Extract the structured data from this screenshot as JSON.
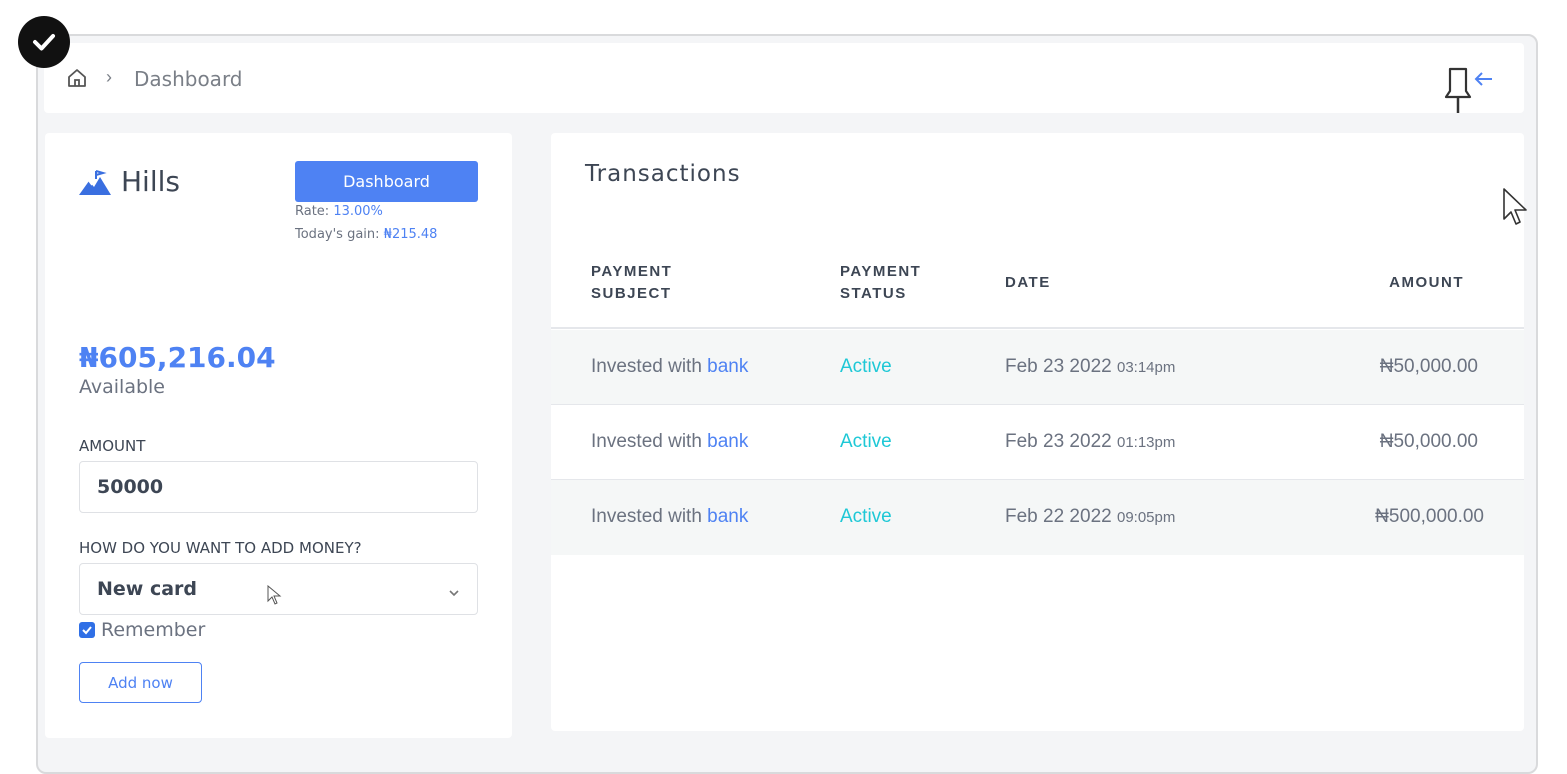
{
  "breadcrumb": {
    "separator": "›",
    "current": "Dashboard"
  },
  "wallet": {
    "brand": "Hills",
    "dashboard_button": "Dashboard",
    "rate_label": "Rate: ",
    "rate_value": "13.00%",
    "gain_label": "Today's gain: ",
    "gain_value": "₦215.48",
    "balance": "₦605,216.04",
    "balance_label": "Available",
    "amount_label": "AMOUNT",
    "amount_value": "50000",
    "method_label": "HOW DO YOU WANT TO ADD MONEY?",
    "method_value": "New card",
    "remember_label": "Remember",
    "remember_checked": true,
    "add_button": "Add now"
  },
  "transactions": {
    "title": "Transactions",
    "headers": {
      "subject": "PAYMENT SUBJECT",
      "status": "PAYMENT STATUS",
      "date": "DATE",
      "amount": "AMOUNT"
    },
    "rows": [
      {
        "subject_prefix": "Invested with ",
        "subject_link": "bank",
        "status": "Active",
        "date": "Feb 23 2022",
        "time": "03:14pm",
        "amount": "₦50,000.00"
      },
      {
        "subject_prefix": "Invested with ",
        "subject_link": "bank",
        "status": "Active",
        "date": "Feb 23 2022",
        "time": "01:13pm",
        "amount": "₦50,000.00"
      },
      {
        "subject_prefix": "Invested with ",
        "subject_link": "bank",
        "status": "Active",
        "date": "Feb 22 2022",
        "time": "09:05pm",
        "amount": "₦500,000.00"
      }
    ]
  },
  "colors": {
    "accent": "#4e82f3",
    "status_active": "#1ec8d6",
    "text": "#3d4654",
    "muted": "#6b7280"
  },
  "icons": [
    "check-badge-icon",
    "home-icon",
    "pin-icon",
    "mountain-logo-icon",
    "chevron-down-icon",
    "checkbox-checked-icon",
    "mouse-cursor-icon"
  ]
}
